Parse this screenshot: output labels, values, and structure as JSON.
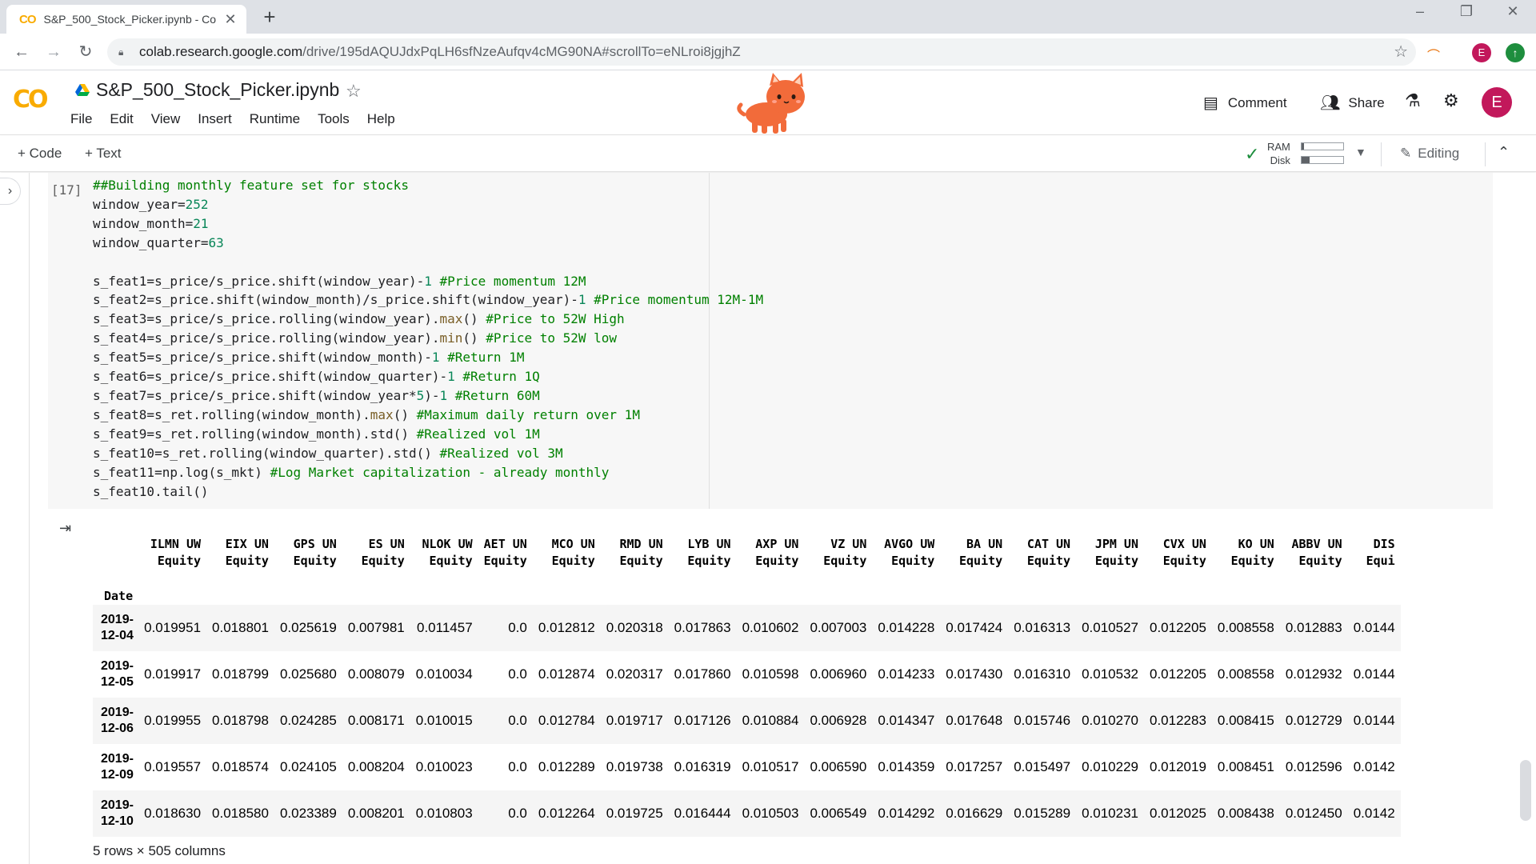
{
  "browser": {
    "tab_title": "S&P_500_Stock_Picker.ipynb - Co",
    "url_host": "colab.research.google.com",
    "url_path": "/drive/195dAQUJdxPqLH6sfNzeAufqv4cMG90NA#scrollTo=eNLroi8jgjhZ",
    "profile_initial": "E"
  },
  "colab": {
    "logo": "CO",
    "notebook_title": "S&P_500_Stock_Picker.ipynb",
    "menu": [
      "File",
      "Edit",
      "View",
      "Insert",
      "Runtime",
      "Tools",
      "Help"
    ],
    "comment_label": "Comment",
    "share_label": "Share",
    "user_initial": "E"
  },
  "toolbar": {
    "add_code": "+ Code",
    "add_text": "+ Text",
    "ram_label": "RAM",
    "disk_label": "Disk",
    "ram_fraction": 0.05,
    "disk_fraction": 0.2,
    "editing_label": "Editing"
  },
  "cell": {
    "exec_count": "[17]",
    "shape_note": "5 rows × 505 columns"
  },
  "df": {
    "columns": [
      [
        "ILMN UW",
        "Equity"
      ],
      [
        "EIX UN",
        "Equity"
      ],
      [
        "GPS UN",
        "Equity"
      ],
      [
        "ES UN",
        "Equity"
      ],
      [
        "NLOK UW",
        "Equity"
      ],
      [
        "AET UN",
        "Equity"
      ],
      [
        "MCO UN",
        "Equity"
      ],
      [
        "RMD UN",
        "Equity"
      ],
      [
        "LYB UN",
        "Equity"
      ],
      [
        "AXP UN",
        "Equity"
      ],
      [
        "VZ UN",
        "Equity"
      ],
      [
        "AVGO UW",
        "Equity"
      ],
      [
        "BA UN",
        "Equity"
      ],
      [
        "CAT UN",
        "Equity"
      ],
      [
        "JPM UN",
        "Equity"
      ],
      [
        "CVX UN",
        "Equity"
      ],
      [
        "KO UN",
        "Equity"
      ],
      [
        "ABBV UN",
        "Equity"
      ],
      [
        "DIS",
        "Equi"
      ]
    ],
    "index_name": "Date",
    "rows": [
      {
        "date": [
          "2019-",
          "12-04"
        ],
        "values": [
          "0.019951",
          "0.018801",
          "0.025619",
          "0.007981",
          "0.011457",
          "0.0",
          "0.012812",
          "0.020318",
          "0.017863",
          "0.010602",
          "0.007003",
          "0.014228",
          "0.017424",
          "0.016313",
          "0.010527",
          "0.012205",
          "0.008558",
          "0.012883",
          "0.0144"
        ]
      },
      {
        "date": [
          "2019-",
          "12-05"
        ],
        "values": [
          "0.019917",
          "0.018799",
          "0.025680",
          "0.008079",
          "0.010034",
          "0.0",
          "0.012874",
          "0.020317",
          "0.017860",
          "0.010598",
          "0.006960",
          "0.014233",
          "0.017430",
          "0.016310",
          "0.010532",
          "0.012205",
          "0.008558",
          "0.012932",
          "0.0144"
        ]
      },
      {
        "date": [
          "2019-",
          "12-06"
        ],
        "values": [
          "0.019955",
          "0.018798",
          "0.024285",
          "0.008171",
          "0.010015",
          "0.0",
          "0.012784",
          "0.019717",
          "0.017126",
          "0.010884",
          "0.006928",
          "0.014347",
          "0.017648",
          "0.015746",
          "0.010270",
          "0.012283",
          "0.008415",
          "0.012729",
          "0.0144"
        ]
      },
      {
        "date": [
          "2019-",
          "12-09"
        ],
        "values": [
          "0.019557",
          "0.018574",
          "0.024105",
          "0.008204",
          "0.010023",
          "0.0",
          "0.012289",
          "0.019738",
          "0.016319",
          "0.010517",
          "0.006590",
          "0.014359",
          "0.017257",
          "0.015497",
          "0.010229",
          "0.012019",
          "0.008451",
          "0.012596",
          "0.0142"
        ]
      },
      {
        "date": [
          "2019-",
          "12-10"
        ],
        "values": [
          "0.018630",
          "0.018580",
          "0.023389",
          "0.008201",
          "0.010803",
          "0.0",
          "0.012264",
          "0.019725",
          "0.016444",
          "0.010503",
          "0.006549",
          "0.014292",
          "0.016629",
          "0.015289",
          "0.010231",
          "0.012025",
          "0.008438",
          "0.012450",
          "0.0142"
        ]
      }
    ]
  }
}
